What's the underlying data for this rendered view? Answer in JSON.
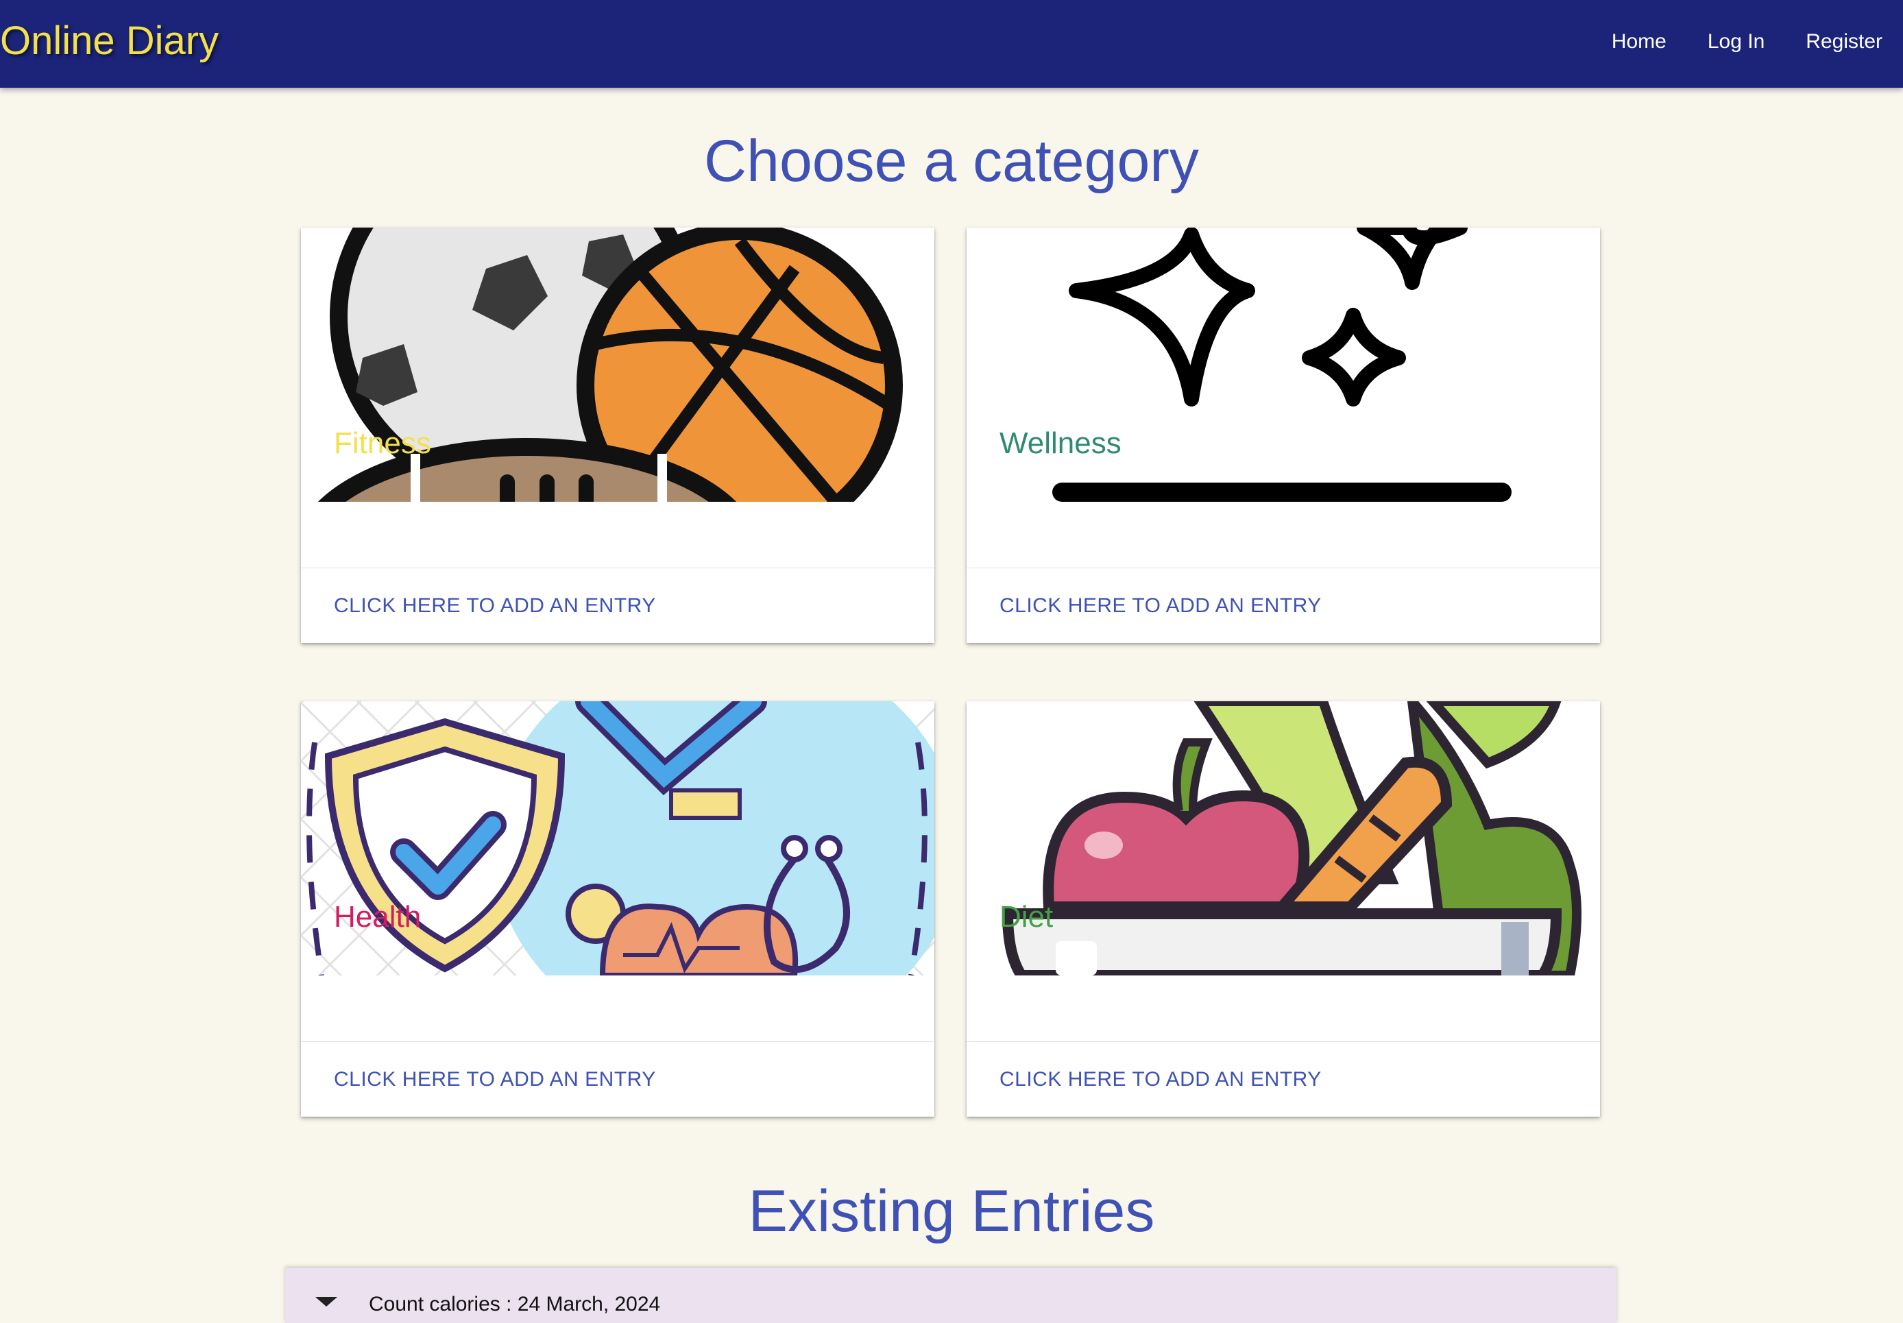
{
  "navbar": {
    "brand": "Online Diary",
    "links": [
      "Home",
      "Log In",
      "Register"
    ]
  },
  "categories_heading": "Choose a category",
  "cards": [
    {
      "title": "Fitness",
      "title_color": "#f4e04d",
      "action": "CLICK HERE TO ADD AN ENTRY",
      "icon": "sports-balls-icon"
    },
    {
      "title": "Wellness",
      "title_color": "#2e8b72",
      "action": "CLICK HERE TO ADD AN ENTRY",
      "icon": "sparkles-icon"
    },
    {
      "title": "Health",
      "title_color": "#d81b60",
      "action": "CLICK HERE TO ADD AN ENTRY",
      "icon": "health-shield-icon"
    },
    {
      "title": "Diet",
      "title_color": "#43a047",
      "action": "CLICK HERE TO ADD AN ENTRY",
      "icon": "fruit-bowl-icon"
    }
  ],
  "entries_heading": "Existing Entries",
  "entries": [
    {
      "label": "Count calories : 24 March, 2024"
    }
  ],
  "colors": {
    "navbar": "#1b2479",
    "brand": "#f4e04d",
    "accent": "#3f51b5",
    "background": "#f9f7ec",
    "entry_panel": "#ebe1ef"
  }
}
